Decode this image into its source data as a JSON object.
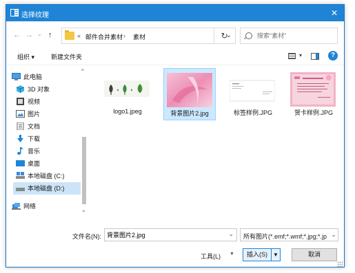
{
  "window": {
    "title": "选择纹理",
    "close_glyph": "✕",
    "accent_color": "#1f84d6",
    "selection_color": "#cce8ff"
  },
  "nav": {
    "back_glyph": "←",
    "forward_glyph": "→",
    "recent_glyph": "⌄",
    "up_glyph": "↑"
  },
  "address": {
    "overflow": "«",
    "crumbs": [
      "邮件合并素材",
      "素材"
    ],
    "separator": "›",
    "dropdown_glyph": "⌄",
    "refresh_glyph": "↻"
  },
  "search": {
    "placeholder": "搜索\"素材\""
  },
  "toolbar": {
    "organize_label": "组织 ▾",
    "new_folder_label": "新建文件夹",
    "view_dropdown_glyph": "▾",
    "help_glyph": "?"
  },
  "sidebar": {
    "items": [
      {
        "label": "此电脑",
        "icon": "computer-icon"
      },
      {
        "label": "3D 对象",
        "icon": "3d-objects-icon"
      },
      {
        "label": "视频",
        "icon": "video-icon"
      },
      {
        "label": "图片",
        "icon": "pictures-icon"
      },
      {
        "label": "文档",
        "icon": "documents-icon"
      },
      {
        "label": "下载",
        "icon": "download-icon"
      },
      {
        "label": "音乐",
        "icon": "music-icon"
      },
      {
        "label": "桌面",
        "icon": "desktop-icon"
      },
      {
        "label": "本地磁盘 (C:)",
        "icon": "drive-c-icon"
      },
      {
        "label": "本地磁盘 (D:)",
        "icon": "drive-d-icon",
        "selected": true
      },
      {
        "label": "网络",
        "icon": "network-icon"
      }
    ],
    "scroll_up_glyph": "^",
    "scroll_down_glyph": "⌄"
  },
  "files": [
    {
      "name": "logo1.jpeg",
      "thumb": "logo-thumbnail"
    },
    {
      "name": "背景图片2.jpg",
      "thumb": "pink-background-thumbnail",
      "selected": true
    },
    {
      "name": "标签样例.JPG",
      "thumb": "label-sample-thumbnail"
    },
    {
      "name": "贺卡样例.JPG",
      "thumb": "greeting-card-thumbnail"
    }
  ],
  "bottom": {
    "filename_label": "文件名(N):",
    "filename_value": "背景图片2.jpg",
    "filename_dropdown_glyph": "⌄",
    "filetype_value": "所有图片(*.emf;*.wmf;*.jpg;*.jp",
    "filetype_dropdown_glyph": "⌄",
    "tools_label": "工具(L)",
    "tools_dropdown_glyph": "▼",
    "insert_label": "插入(S)",
    "insert_split_glyph": "▼",
    "cancel_label": "取消"
  }
}
